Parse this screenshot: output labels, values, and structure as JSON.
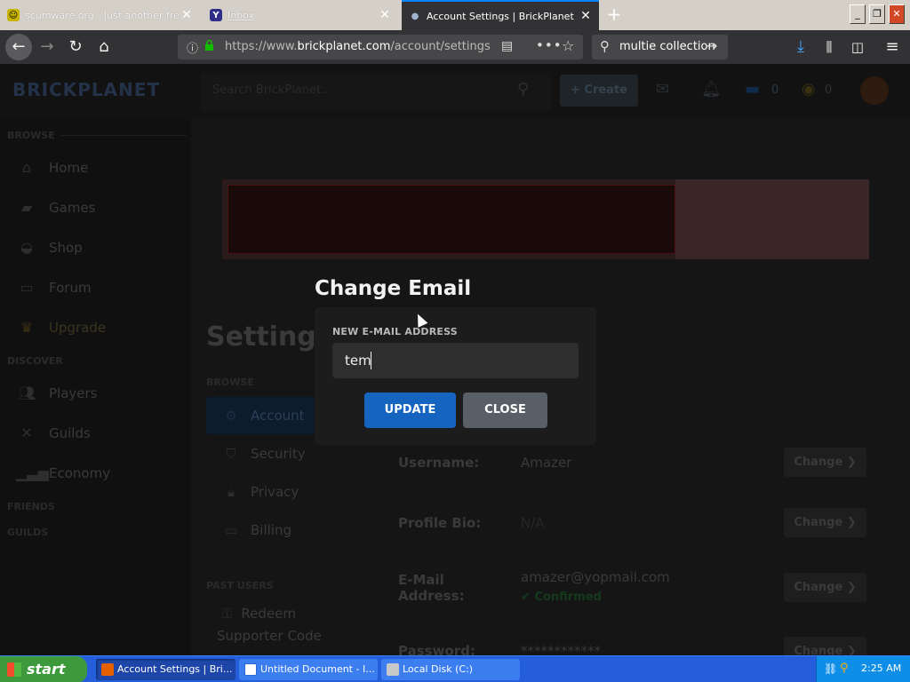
{
  "browser": {
    "tabs": [
      {
        "title": "scumware.org - Just another fre",
        "favicon": "smiley-icon"
      },
      {
        "title": "Inbox",
        "favicon": "yahoo-icon",
        "favicon_char": "Y"
      },
      {
        "title": "Account Settings | BrickPlanet",
        "favicon": "brickplanet-icon"
      }
    ],
    "url_prefix": "https://www.",
    "url_domain": "brickplanet.com",
    "url_path": "/account/settings",
    "search_value": "multie collection"
  },
  "site": {
    "logo": "BRICKPLANET",
    "search_placeholder": "Search BrickPlanet...",
    "create_label": "+ Create",
    "currency1": "0",
    "currency2": "0",
    "sidebar": {
      "browse_head": "BROWSE",
      "items": [
        "Home",
        "Games",
        "Shop",
        "Forum",
        "Upgrade"
      ],
      "discover_head": "DISCOVER",
      "discover_items": [
        "Players",
        "Guilds",
        "Economy"
      ],
      "friends_head": "FRIENDS",
      "guilds_head": "GUILDS"
    },
    "settings": {
      "title": "Settings",
      "browse_head": "BROWSE",
      "tabs": [
        "Account",
        "Security",
        "Privacy",
        "Billing"
      ],
      "past_users_head": "PAST USERS",
      "redeem_line1": "Redeem",
      "redeem_line2": "Supporter Code",
      "rows": [
        {
          "label": "Username:",
          "value": "Amazer",
          "button": "Change ❯"
        },
        {
          "label": "Profile Bio:",
          "value": "N/A",
          "button": "Change ❯"
        },
        {
          "label_line1": "E-Mail",
          "label_line2": "Address:",
          "value": "amazer@yopmail.com",
          "status": "Confirmed",
          "button": "Change ❯"
        },
        {
          "label": "Password:",
          "value": "************",
          "button": "Change ❯"
        }
      ]
    }
  },
  "modal": {
    "title": "Change Email",
    "field_label": "NEW E-MAIL ADDRESS",
    "field_value": "tem",
    "update_label": "UPDATE",
    "close_label": "CLOSE"
  },
  "taskbar": {
    "start_label": "start",
    "tasks": [
      "Account Settings | Bri...",
      "Untitled Document - I...",
      "Local Disk (C:)"
    ],
    "clock": "2:25 AM"
  },
  "colors": {
    "accent_blue": "#1565c0",
    "close_gray": "#595f66",
    "modal_bg": "#1c1c1c"
  }
}
